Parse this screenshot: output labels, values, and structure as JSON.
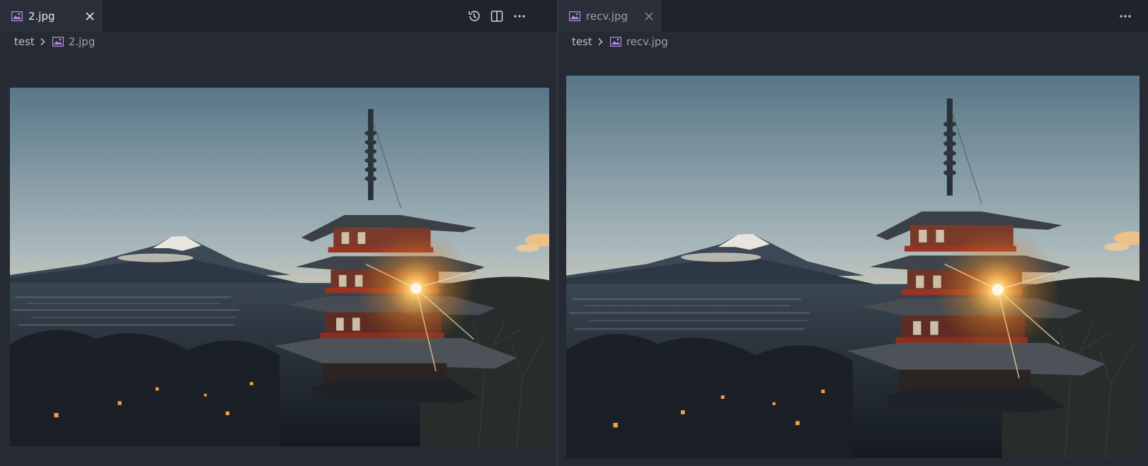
{
  "editors": [
    {
      "tab": {
        "label": "2.jpg",
        "active": true
      },
      "breadcrumb": {
        "folder": "test",
        "file": "2.jpg"
      },
      "actions": [
        "history-icon",
        "split-editor-icon",
        "more-actions-icon"
      ]
    },
    {
      "tab": {
        "label": "recv.jpg",
        "active": false
      },
      "breadcrumb": {
        "folder": "test",
        "file": "recv.jpg"
      },
      "actions": [
        "more-actions-icon"
      ]
    }
  ],
  "colors": {
    "background": "#262a33",
    "tabbar": "#1f232b",
    "image_file_icon": "#b48ee0",
    "sky_top": "#5d7c8e",
    "sky_horizon": "#f1c58d",
    "sun": "#ffb347"
  }
}
